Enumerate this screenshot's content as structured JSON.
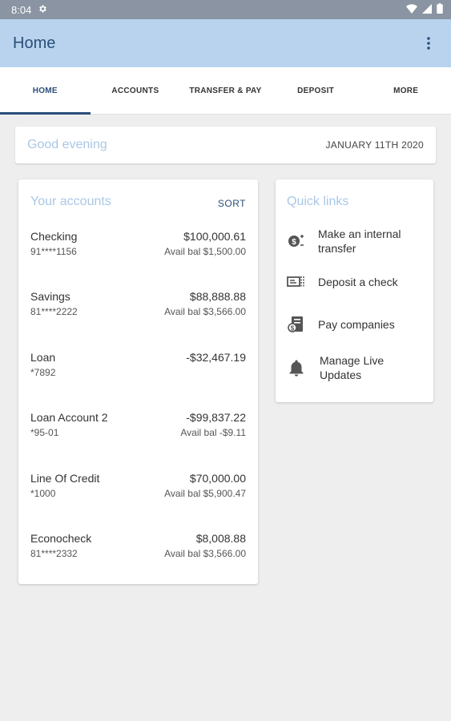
{
  "status_bar": {
    "time": "8:04",
    "icons": [
      "gear-icon",
      "wifi-icon",
      "signal-icon",
      "battery-icon"
    ]
  },
  "app_bar": {
    "title": "Home",
    "menu_icon": "more-vert-icon"
  },
  "tabs": [
    {
      "label": "HOME",
      "active": true
    },
    {
      "label": "ACCOUNTS",
      "active": false
    },
    {
      "label": "TRANSFER & PAY",
      "active": false
    },
    {
      "label": "DEPOSIT",
      "active": false
    },
    {
      "label": "MORE",
      "active": false
    }
  ],
  "greeting": {
    "text": "Good evening",
    "date": "JANUARY 11TH 2020"
  },
  "accounts": {
    "title": "Your accounts",
    "sort_label": "SORT",
    "items": [
      {
        "name": "Checking",
        "number": "91****1156",
        "balance": "$100,000.61",
        "avail": "Avail bal $1,500.00"
      },
      {
        "name": "Savings",
        "number": "81****2222",
        "balance": "$88,888.88",
        "avail": "Avail bal $3,566.00"
      },
      {
        "name": "Loan",
        "number": "*7892",
        "balance": "-$32,467.19",
        "avail": ""
      },
      {
        "name": "Loan Account 2",
        "number": "*95-01",
        "balance": "-$99,837.22",
        "avail": "Avail bal -$9.11"
      },
      {
        "name": "Line Of Credit",
        "number": "*1000",
        "balance": "$70,000.00",
        "avail": "Avail bal $5,900.47"
      },
      {
        "name": "Econocheck",
        "number": "81****2332",
        "balance": "$8,008.88",
        "avail": "Avail bal $3,566.00"
      }
    ]
  },
  "quick_links": {
    "title": "Quick links",
    "items": [
      {
        "label": "Make an internal transfer",
        "icon": "transfer-icon"
      },
      {
        "label": "Deposit a check",
        "icon": "check-deposit-icon"
      },
      {
        "label": "Pay companies",
        "icon": "bill-pay-icon"
      },
      {
        "label": "Manage Live Updates",
        "icon": "bell-icon"
      }
    ]
  },
  "colors": {
    "status_bar": "#8a94a3",
    "app_bar": "#b9d3ee",
    "accent": "#2a4f7a",
    "light_accent": "#a9c7e6",
    "background": "#eeeeee"
  }
}
